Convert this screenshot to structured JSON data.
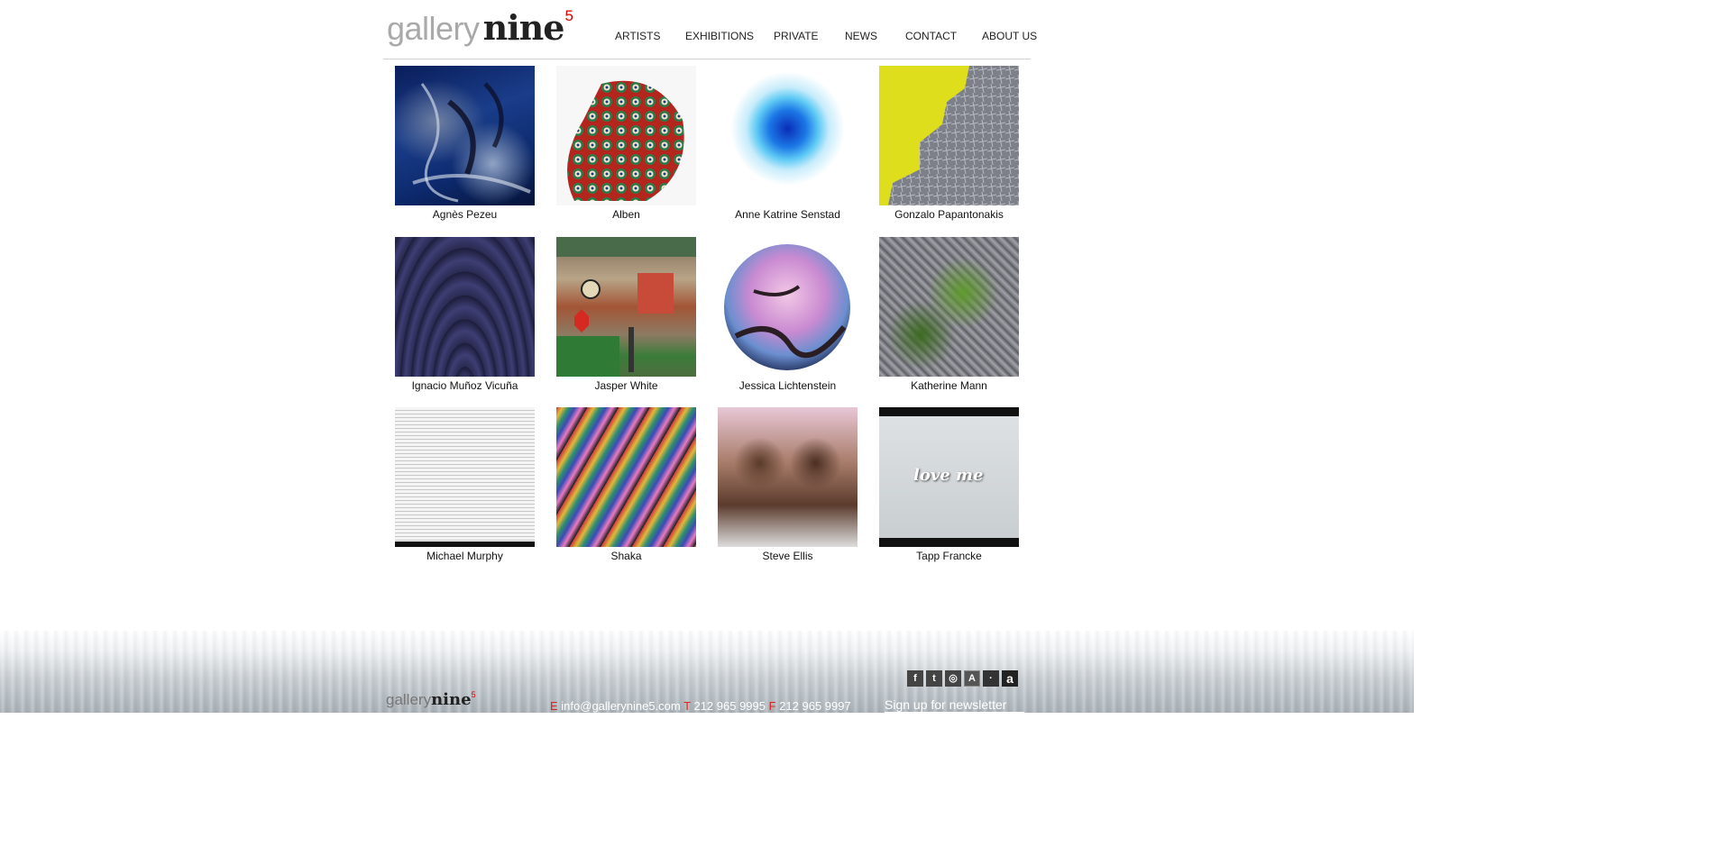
{
  "brand": {
    "word1": "gallery",
    "word2": "nine",
    "sup": "5"
  },
  "nav": [
    {
      "label": "ARTISTS"
    },
    {
      "label": "EXHIBITIONS"
    },
    {
      "label": "PRIVATE"
    },
    {
      "label": "NEWS"
    },
    {
      "label": "CONTACT"
    },
    {
      "label": "ABOUT US"
    }
  ],
  "artists": [
    {
      "name": "Agnès Pezeu",
      "art": "blue-abstract"
    },
    {
      "name": "Alben",
      "art": "dotted-sculpture"
    },
    {
      "name": "Anne Katrine Senstad",
      "art": "blue-orb"
    },
    {
      "name": "Gonzalo Papantonakis",
      "art": "yellow-map"
    },
    {
      "name": "Ignacio Muñoz Vicuña",
      "art": "navy-drapery"
    },
    {
      "name": "Jasper White",
      "art": "bar-interior"
    },
    {
      "name": "Jessica Lichtenstein",
      "art": "cherry-blossom-circle"
    },
    {
      "name": "Katherine Mann",
      "art": "grey-green-collage"
    },
    {
      "name": "Michael Murphy",
      "art": "dotted-grey"
    },
    {
      "name": "Shaka",
      "art": "colorful-swirls"
    },
    {
      "name": "Steve Ellis",
      "art": "face-collage"
    },
    {
      "name": "Tapp Francke",
      "art": "love-me-neon"
    }
  ],
  "footer": {
    "email_key": "E",
    "email": "info@gallerynine5.com",
    "phone_key": "T",
    "phone": "212 965 9995",
    "fax_key": "F",
    "fax": "212 965 9997",
    "newsletter": "Sign up for newsletter",
    "social": [
      {
        "icon": "facebook-icon",
        "glyph": "f"
      },
      {
        "icon": "twitter-icon",
        "glyph": "t"
      },
      {
        "icon": "instagram-icon",
        "glyph": "◎"
      },
      {
        "icon": "artsy-icon",
        "glyph": "A"
      },
      {
        "icon": "artnet-icon",
        "glyph": "·"
      },
      {
        "icon": "amazon-icon",
        "glyph": "a"
      }
    ]
  }
}
